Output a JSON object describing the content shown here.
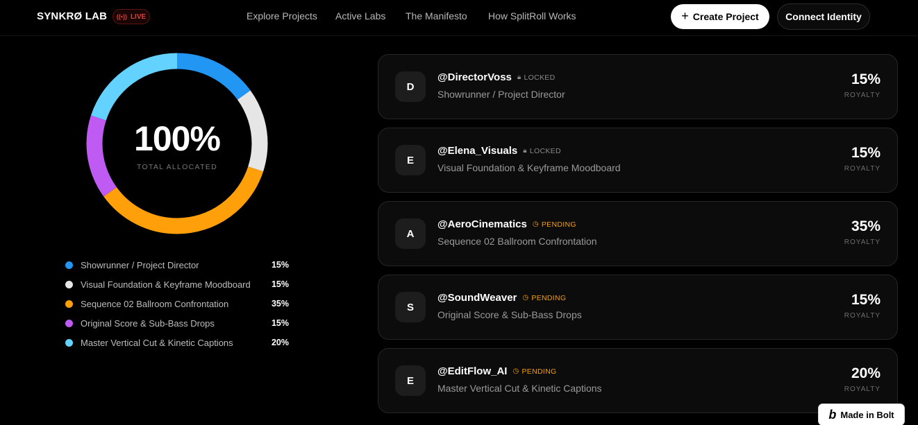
{
  "header": {
    "brand": "SYNKRØ LAB",
    "live_label": "LIVE",
    "live_icon": "broadcast-icon",
    "nav": [
      {
        "label": "Explore Projects"
      },
      {
        "label": "Active Labs"
      },
      {
        "label": "The Manifesto"
      },
      {
        "label": "How SplitRoll Works"
      }
    ],
    "create_label": "Create Project",
    "connect_label": "Connect Identity"
  },
  "allocation": {
    "total_value": "100%",
    "total_label": "TOTAL ALLOCATED",
    "legend": [
      {
        "label": "Showrunner / Project Director",
        "value": "15%",
        "percent": 15,
        "color": "#2196f3"
      },
      {
        "label": "Visual Foundation & Keyframe Moodboard",
        "value": "15%",
        "percent": 15,
        "color": "#e6e6e6"
      },
      {
        "label": "Sequence 02 Ballroom Confrontation",
        "value": "35%",
        "percent": 35,
        "color": "#ff9f0a"
      },
      {
        "label": "Original Score & Sub-Bass Drops",
        "value": "15%",
        "percent": 15,
        "color": "#bf5af2"
      },
      {
        "label": "Master Vertical Cut & Kinetic Captions",
        "value": "20%",
        "percent": 20,
        "color": "#64d2ff"
      }
    ]
  },
  "contributors": [
    {
      "initial": "D",
      "handle": "@DirectorVoss",
      "status": "LOCKED",
      "status_type": "locked",
      "role": "Showrunner / Project Director",
      "pct": "15%",
      "pct_label": "ROYALTY"
    },
    {
      "initial": "E",
      "handle": "@Elena_Visuals",
      "status": "LOCKED",
      "status_type": "locked",
      "role": "Visual Foundation & Keyframe Moodboard",
      "pct": "15%",
      "pct_label": "ROYALTY"
    },
    {
      "initial": "A",
      "handle": "@AeroCinematics",
      "status": "PENDING",
      "status_type": "pending",
      "role": "Sequence 02 Ballroom Confrontation",
      "pct": "35%",
      "pct_label": "ROYALTY"
    },
    {
      "initial": "S",
      "handle": "@SoundWeaver",
      "status": "PENDING",
      "status_type": "pending",
      "role": "Original Score & Sub-Bass Drops",
      "pct": "15%",
      "pct_label": "ROYALTY"
    },
    {
      "initial": "E",
      "handle": "@EditFlow_AI",
      "status": "PENDING",
      "status_type": "pending",
      "role": "Master Vertical Cut & Kinetic Captions",
      "pct": "20%",
      "pct_label": "ROYALTY"
    }
  ],
  "badge": {
    "logo": "b",
    "label": "Made in Bolt"
  }
}
